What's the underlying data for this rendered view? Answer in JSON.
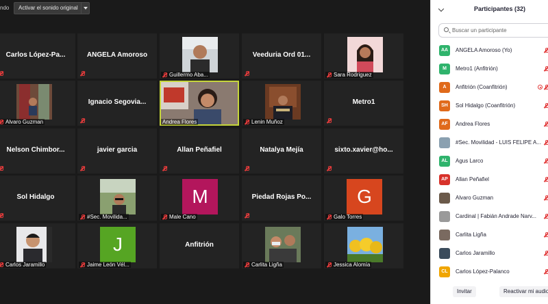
{
  "topbar": {
    "partial_label": "ndo",
    "sound_button": "Activar el sonido original"
  },
  "tiles": [
    {
      "name": "Carlos  López-Pa..."
    },
    {
      "name": "ANGELA Amoroso"
    },
    {
      "label": "Guillermo Aba..."
    },
    {
      "name": "Veeduria Ord 01..."
    },
    {
      "label": "Sara Rodriguez"
    },
    {
      "label": "Alvaro Guzman"
    },
    {
      "name": "Ignacio  Segovia..."
    },
    {
      "label": "Andrea Flores"
    },
    {
      "label": "Lenin Muñoz"
    },
    {
      "name": "Metro1"
    },
    {
      "name": "Nelson  Chimbor..."
    },
    {
      "name": "javier garcia"
    },
    {
      "name": "Allan Peñafiel"
    },
    {
      "name": "Natalya Mejía"
    },
    {
      "name": "sixto.xavier@ho..."
    },
    {
      "name": "Sol Hidalgo"
    },
    {
      "label": "#Sec. Movilida..."
    },
    {
      "label": "Male Cano",
      "avatar_letter": "M"
    },
    {
      "name": "Piedad  Rojas Po..."
    },
    {
      "label": "Galo Torres",
      "avatar_letter": "G"
    },
    {
      "label": "Carlos Jaramillo"
    },
    {
      "label": "Jaime León Vél...",
      "avatar_letter": "J"
    },
    {
      "name": "Anfitrión"
    },
    {
      "label": "Carlita Ligña"
    },
    {
      "label": "Jessica Alomía"
    }
  ],
  "panel": {
    "title": "Participantes (32)",
    "search_placeholder": "Buscar un participante",
    "participants": [
      {
        "initials": "AA",
        "color": "#2fb36c",
        "name": "ANGELA Amoroso (Yo)"
      },
      {
        "initials": "M",
        "color": "#2fb36c",
        "name": "Metro1 (Anfitrión)"
      },
      {
        "initials": "A",
        "color": "#e06a1b",
        "name": "Anfitrión (Coanfitrión)"
      },
      {
        "initials": "SH",
        "color": "#e06a1b",
        "name": "Sol Hidalgo (Coanfitrión)"
      },
      {
        "initials": "AF",
        "color": "#e06a1b",
        "name": "Andrea Flores"
      },
      {
        "initials": "",
        "color": "#8aa0b0",
        "name": "#Sec. Movilidad - LUIS FELIPE A..."
      },
      {
        "initials": "AL",
        "color": "#2fb36c",
        "name": "Agus Larco"
      },
      {
        "initials": "AP",
        "color": "#d8322b",
        "name": "Allan Peñafiel"
      },
      {
        "initials": "",
        "color": "#6b5a4a",
        "name": "Alvaro Guzman"
      },
      {
        "initials": "",
        "color": "#9a9a9a",
        "name": "Cardinal | Fabián Andrade Narv..."
      },
      {
        "initials": "",
        "color": "#7a6a60",
        "name": "Carlita Ligña"
      },
      {
        "initials": "",
        "color": "#3b4c5c",
        "name": "Carlos Jaramillo"
      },
      {
        "initials": "CL",
        "color": "#f0a500",
        "name": "Carlos López-Palanco"
      }
    ],
    "invite_button": "Invitar",
    "unmute_button": "Reactivar mi audio"
  }
}
